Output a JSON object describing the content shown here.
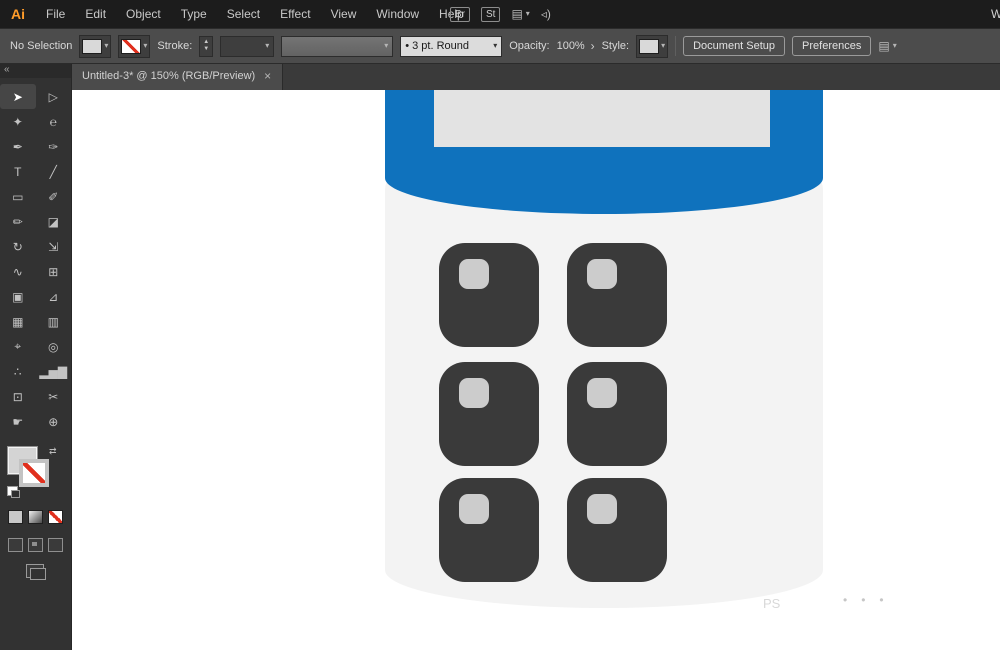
{
  "theme": {
    "menubar-bg": "#1c1c1c",
    "controlbar-bg": "#4c4c4c",
    "panel-bg": "#323232",
    "tabstrip-bg": "#3a3a3a",
    "tab-bg": "#4b4b4b",
    "accent-blue": "#0f72bd",
    "device-body": "#f3f3f3",
    "device-screen": "#e3e3e3",
    "key-dark": "#3a3a3a",
    "keycap": "#cccccc",
    "none-red": "#e0301e"
  },
  "icons": {
    "dropdown": "▾",
    "stepper_up": "▲",
    "stepper_down": "▼",
    "chevron_right": "›",
    "close": "×",
    "collapse": "«",
    "workspace": "▤",
    "megaphone": "◃)",
    "swap": "⇄"
  },
  "menubar": {
    "logo": "Ai",
    "items": [
      "File",
      "Edit",
      "Object",
      "Type",
      "Select",
      "Effect",
      "View",
      "Window",
      "Help"
    ],
    "bridge_label": "Br",
    "stock_label": "St",
    "partial_right_text": "W"
  },
  "controlbar": {
    "no_selection": "No Selection",
    "stroke_label": "Stroke:",
    "brush_profile": "•  3 pt. Round",
    "opacity_label": "Opacity:",
    "opacity_value": "100%",
    "style_label": "Style:",
    "document_setup": "Document Setup",
    "preferences": "Preferences"
  },
  "tabbar": {
    "title": "Untitled-3* @ 150% (RGB/Preview)"
  },
  "toolbar": {
    "tools": [
      {
        "name": "selection-tool",
        "glyph": "➤"
      },
      {
        "name": "direct-selection-tool",
        "glyph": "▷"
      },
      {
        "name": "magic-wand-tool",
        "glyph": "✦"
      },
      {
        "name": "lasso-tool",
        "glyph": "℮"
      },
      {
        "name": "pen-tool",
        "glyph": "✒"
      },
      {
        "name": "curvature-tool",
        "glyph": "✑"
      },
      {
        "name": "type-tool",
        "glyph": "T"
      },
      {
        "name": "line-segment-tool",
        "glyph": "╱"
      },
      {
        "name": "rectangle-tool",
        "glyph": "▭"
      },
      {
        "name": "paintbrush-tool",
        "glyph": "✐"
      },
      {
        "name": "pencil-tool",
        "glyph": "✏"
      },
      {
        "name": "eraser-tool",
        "glyph": "◪"
      },
      {
        "name": "rotate-tool",
        "glyph": "↻"
      },
      {
        "name": "scale-tool",
        "glyph": "⇲"
      },
      {
        "name": "width-tool",
        "glyph": "∿"
      },
      {
        "name": "free-transform-tool",
        "glyph": "⊞"
      },
      {
        "name": "shape-builder-tool",
        "glyph": "▣"
      },
      {
        "name": "perspective-grid-tool",
        "glyph": "⊿"
      },
      {
        "name": "mesh-tool",
        "glyph": "▦"
      },
      {
        "name": "gradient-tool",
        "glyph": "▥"
      },
      {
        "name": "eyedropper-tool",
        "glyph": "⌖"
      },
      {
        "name": "blend-tool",
        "glyph": "◎"
      },
      {
        "name": "symbol-sprayer-tool",
        "glyph": "∴"
      },
      {
        "name": "column-graph-tool",
        "glyph": "▂▅▇"
      },
      {
        "name": "artboard-tool",
        "glyph": "⊡"
      },
      {
        "name": "slice-tool",
        "glyph": "✂"
      },
      {
        "name": "hand-tool",
        "glyph": "☛"
      },
      {
        "name": "zoom-tool",
        "glyph": "⊕"
      }
    ]
  },
  "canvas": {
    "watermark": "PS",
    "dots": "•••"
  }
}
